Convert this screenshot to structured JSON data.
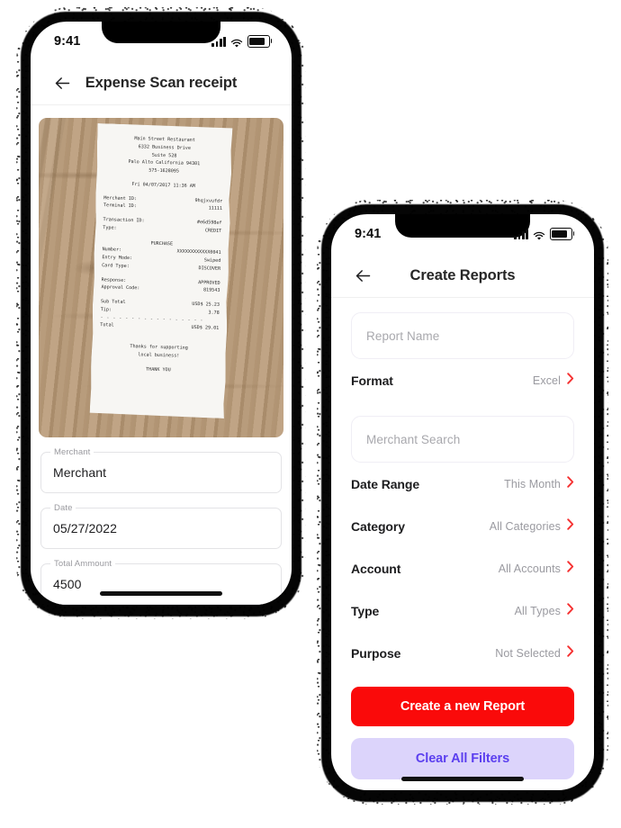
{
  "left_phone": {
    "status_bar": {
      "time": "9:41",
      "cellular_icon": "signal-bars-icon",
      "wifi_icon": "wifi-icon",
      "battery_icon": "battery-icon"
    },
    "nav": {
      "back_icon": "back-arrow-icon",
      "title": "Expense Scan receipt"
    },
    "receipt_photo": {
      "name": "receipt-photograph",
      "background_color": "#b49878",
      "paper_color": "#f7f6f3",
      "lines": {
        "store_name": "Main Street Restaurant",
        "address_1": "6332 Business Drive",
        "address_2": "Suite 528",
        "address_3": "Palo Alto California 94301",
        "phone": "575-1628095",
        "datetime": "Fri 04/07/2017 11:36 AM",
        "merchant_id_label": "Merchant ID:",
        "merchant_id_value": "9hqjxvufdr",
        "terminal_id_label": "Terminal ID:",
        "terminal_id_value": "11111",
        "transaction_id_label": "Transaction ID:",
        "transaction_id_value": "#e6d598ef",
        "type_label": "Type:",
        "type_value": "CREDIT",
        "purchase_heading": "PURCHASE",
        "number_label": "Number:",
        "number_value": "XXXXXXXXXXXX0041",
        "entry_mode_label": "Entry Mode:",
        "entry_mode_value": "Swiped",
        "card_type_label": "Card Type:",
        "card_type_value": "DISCOVER",
        "response_label": "Response:",
        "response_value": "APPROVED",
        "approval_code_label": "Approval Code:",
        "approval_code_value": "819543",
        "sub_total_label": "Sub Total",
        "sub_total_value": "USD$ 25.23",
        "tip_label": "Tip:",
        "tip_value": "3.78",
        "divider": "- - - - - - - - - - - - - - - - -",
        "total_label": "Total",
        "total_value": "USD$ 29.01",
        "thanks_1": "Thanks for supporting",
        "thanks_2": "local business!",
        "thank_you": "THANK YOU"
      }
    },
    "fields": [
      {
        "label": "Merchant",
        "value": "Merchant"
      },
      {
        "label": "Date",
        "value": "05/27/2022"
      },
      {
        "label": "Total Ammount",
        "value": "4500"
      }
    ]
  },
  "right_phone": {
    "status_bar": {
      "time": "9:41",
      "cellular_icon": "signal-bars-icon",
      "wifi_icon": "wifi-icon",
      "battery_icon": "battery-icon"
    },
    "nav": {
      "back_icon": "back-arrow-icon",
      "title": "Create Reports"
    },
    "report_name_input": {
      "placeholder": "Report Name",
      "value": ""
    },
    "merchant_search_input": {
      "placeholder": "Merchant Search",
      "value": ""
    },
    "filters": [
      {
        "label": "Format",
        "value": "Excel",
        "chevron_icon": "chevron-right-icon"
      },
      {
        "label": "Date Range",
        "value": "This Month",
        "chevron_icon": "chevron-right-icon"
      },
      {
        "label": "Category",
        "value": "All Categories",
        "chevron_icon": "chevron-right-icon"
      },
      {
        "label": "Account",
        "value": "All Accounts",
        "chevron_icon": "chevron-right-icon"
      },
      {
        "label": "Type",
        "value": "All Types",
        "chevron_icon": "chevron-right-icon"
      },
      {
        "label": "Purpose",
        "value": "Not Selected",
        "chevron_icon": "chevron-right-icon"
      }
    ],
    "primary_button": {
      "label": "Create a new Report",
      "color": "#FA0A0A",
      "text_color": "#FFFFFF"
    },
    "secondary_button": {
      "label": "Clear All Filters",
      "color": "#DCD4FB",
      "text_color": "#5B3FEF"
    }
  },
  "theme": {
    "accent_red": "#FA0A0A",
    "accent_purple": "#5B3FEF",
    "chevron_red": "#F53030",
    "text_dark": "#1D1D1F",
    "text_muted": "#9A9AA0"
  }
}
